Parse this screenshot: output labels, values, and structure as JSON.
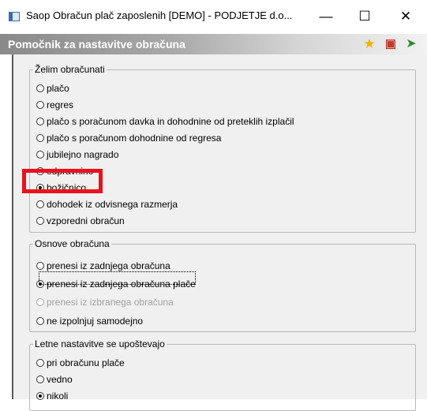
{
  "window": {
    "title": "Saop Obračun plač zaposlenih [DEMO] - PODJETJE d.o...",
    "minimize": "—",
    "maximize": "☐",
    "close": "✕"
  },
  "header": {
    "title": "Pomočnik za nastavitve obračuna",
    "icons": [
      "star-icon",
      "calculator-icon",
      "exit-icon"
    ]
  },
  "groups": {
    "zelim": {
      "legend": "Želim obračunati",
      "options": [
        "plačo",
        "regres",
        "plačo s poračunom davka in dohodnine od preteklih izplačil",
        "plačo s poračunom dohodnine od regresa",
        "jubilejno nagrado",
        "odpravnino",
        "božičnico",
        "dohodek iz odvisnega razmerja",
        "vzporedni obračun"
      ],
      "selected": "božičnico"
    },
    "osnove": {
      "legend": "Osnove obračuna",
      "options": [
        "prenesi iz zadnjega obračuna",
        "prenesi iz zadnjega obračuna plače",
        "prenesi iz izbranega obračuna",
        "ne izpolnjuj samodejno"
      ],
      "selected": "prenesi iz zadnjega obračuna plače",
      "disabled": "prenesi iz izbranega obračuna"
    },
    "letne": {
      "legend": "Letne nastavitve se upoštevajo",
      "options": [
        "pri obračunu plače",
        "vedno",
        "nikoli"
      ],
      "selected": "nikoli"
    }
  },
  "colors": {
    "highlight": "#e8121c",
    "header_text": "#ffffff"
  }
}
